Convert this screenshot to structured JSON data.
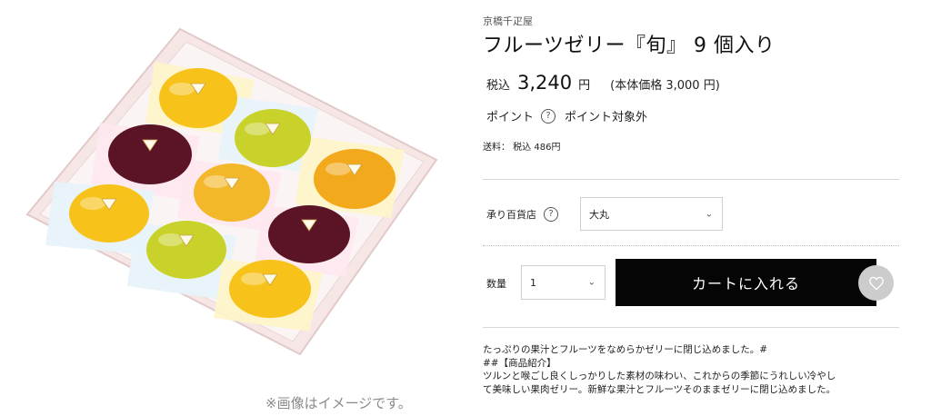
{
  "image": {
    "alt_icon": "jelly-box-product-image",
    "caption": "※画像はイメージです。",
    "colors": {
      "box_frame": "#f6e6e6",
      "box_border": "#e2c9c9",
      "yellow_jelly": "#f7c21a",
      "orange_jelly": "#f3a91c",
      "green_jelly": "#c9d22a",
      "grape_jelly": "#5a1426"
    }
  },
  "product": {
    "brand": "京橋千疋屋",
    "title": "フルーツゼリー『旬』 9 個入り",
    "price_prefix": "税込",
    "price_value": "3,240",
    "price_unit": "円",
    "price_base": "(本体価格 3,000 円)",
    "point_label": "ポイント",
    "point_value": "ポイント対象外",
    "shipping": "送料： 税込 486円"
  },
  "form": {
    "store_label": "承り百貨店",
    "store_selected": "大丸",
    "quantity_label": "数量",
    "quantity_selected": "1",
    "cart_button": "カートに入れる"
  },
  "description": {
    "line1": "たっぷりの果汁とフルーツをなめらかゼリーに閉じ込めました。#",
    "line2": "##【商品紹介】",
    "line3": "ツルンと喉ごし良くしっかりした素材の味わい、これからの季節にうれしい冷やし",
    "line4": "て美味しい果肉ゼリー。新鮮な果汁とフルーツそのままゼリーに閉じ込めました。"
  },
  "colors": {
    "cart_button_bg": "#050505",
    "fav_button_bg": "#cccccc"
  }
}
